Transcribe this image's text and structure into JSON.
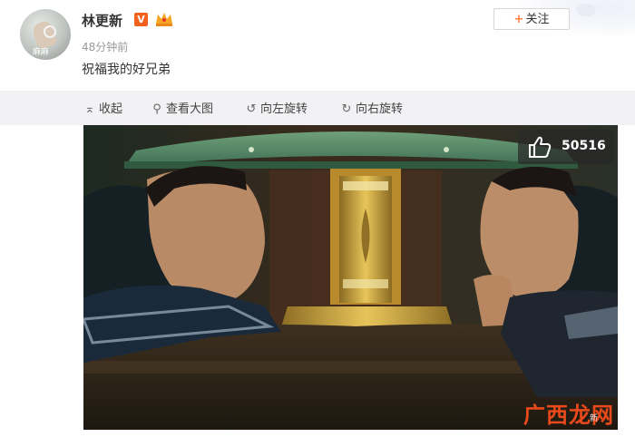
{
  "post": {
    "username": "林更新",
    "vip_badge": "V",
    "time": "48分钟前",
    "text": "祝福我的好兄弟",
    "avatar_tag": "麻麻",
    "follow_button_label": "关注",
    "follow_button_plus": "+"
  },
  "actions": [
    {
      "icon": "collapse-arrow-icon",
      "glyph": "⌅",
      "label": "收起"
    },
    {
      "icon": "search-icon",
      "glyph": "⚲",
      "label": "查看大图"
    },
    {
      "icon": "rotate-left-icon",
      "glyph": "↺",
      "label": "向左旋转"
    },
    {
      "icon": "rotate-right-icon",
      "glyph": "↻",
      "label": "向右旋转"
    }
  ],
  "photo": {
    "like_count": "50516"
  },
  "watermark": {
    "text": "广西龙网",
    "sub": "新"
  },
  "colors": {
    "accent_orange": "#ff8140",
    "vip_badge": "#f2611d",
    "action_bar_bg": "#f2f2f5",
    "watermark_red": "#e84a1b"
  }
}
